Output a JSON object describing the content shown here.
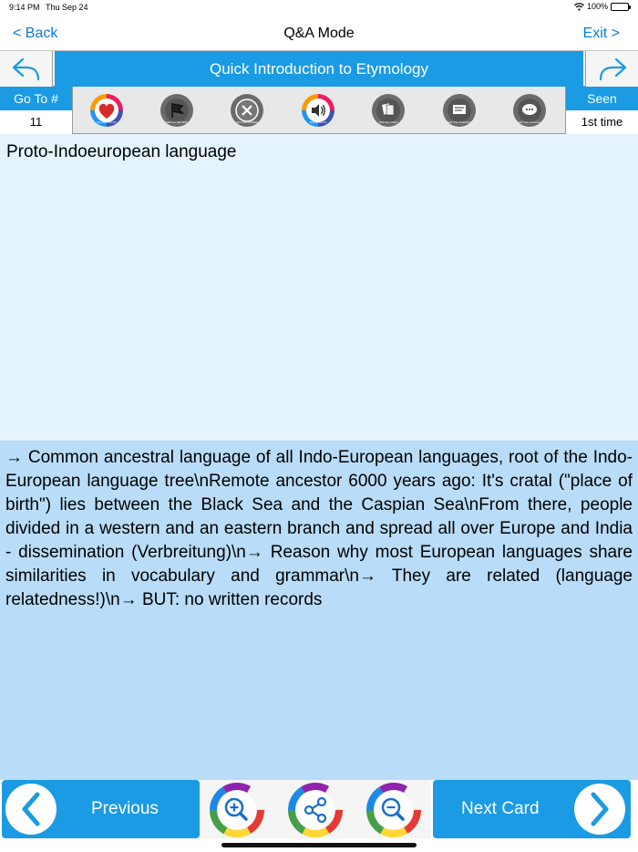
{
  "status": {
    "time": "9:14 PM",
    "date": "Thu Sep 24",
    "battery": "100%"
  },
  "nav": {
    "back_label": "< Back",
    "title": "Q&A Mode",
    "exit_label": "Exit >"
  },
  "deck": {
    "title": "Quick Introduction to Etymology"
  },
  "goto": {
    "label": "Go To #",
    "value": "11"
  },
  "seen": {
    "label": "Seen",
    "value": "1st time"
  },
  "tools": [
    {
      "name": "heart-icon",
      "label": "My FAVORITES"
    },
    {
      "name": "flag-icon",
      "label": "Mark for REVIEW"
    },
    {
      "name": "remove-icon",
      "label": "Remove MISSED"
    },
    {
      "name": "speaker-icon",
      "label": "SPEAKER On"
    },
    {
      "name": "cards-icon",
      "label": "Add Own Cards"
    },
    {
      "name": "edit-flashcard-icon",
      "label": "Edit This Flashcard"
    },
    {
      "name": "comment-icon",
      "label": "Add Your Comment"
    }
  ],
  "card": {
    "question": "Proto-Indoeuropean language",
    "answer": "→ Common ancestral language of all Indo-European languages, root of the Indo-European language tree\\nRemote ancestor 6000 years ago: It's cratal (\"place of birth\") lies between the Black Sea and the Caspian Sea\\nFrom there, people divided in a western and an eastern branch and spread all over Europe and India - dissemination (Verbreitung)\\n→ Reason why most European languages share similarities in vocabulary and grammar\\n→ They are related (language relatedness!)\\n→ BUT: no written records"
  },
  "bottom": {
    "previous_label": "Previous",
    "next_label": "Next Card"
  },
  "colors": {
    "accent": "#1a9be3",
    "link": "#0a7ad6",
    "question_bg": "#e4f3fd",
    "answer_bg": "#b9dcf8"
  }
}
